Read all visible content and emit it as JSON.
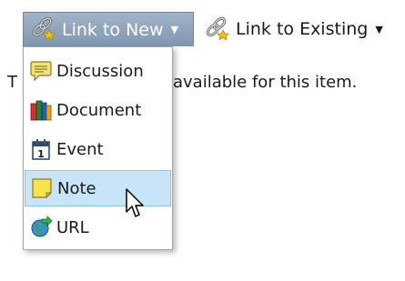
{
  "toolbar": {
    "link_new_label": "Link to New",
    "link_existing_label": "Link to Existing"
  },
  "background_text": {
    "left_fragment": "T",
    "right_fragment": "available for this item."
  },
  "menu": {
    "items": [
      {
        "label": "Discussion",
        "icon": "discussion-icon"
      },
      {
        "label": "Document",
        "icon": "document-icon"
      },
      {
        "label": "Event",
        "icon": "calendar-event-icon"
      },
      {
        "label": "Note",
        "icon": "note-icon",
        "highlighted": true
      },
      {
        "label": "URL",
        "icon": "url-globe-icon"
      }
    ]
  },
  "colors": {
    "active_button": "#8fa3bd",
    "menu_highlight": "#c7e4f8"
  }
}
